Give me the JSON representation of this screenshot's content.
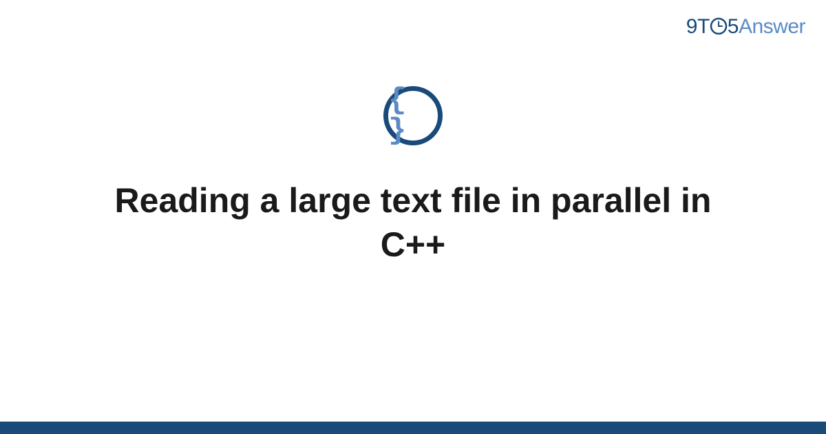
{
  "brand": {
    "nine": "9",
    "t": "T",
    "five": "5",
    "answer": "Answer"
  },
  "icon": {
    "braces": "{ }"
  },
  "title": "Reading a large text file in parallel in C++",
  "colors": {
    "primary": "#1a4a7a",
    "secondary": "#5a8bc4"
  }
}
